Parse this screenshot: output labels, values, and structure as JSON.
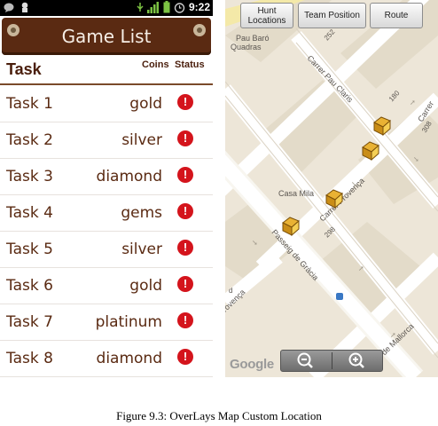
{
  "status_bar": {
    "time": "9:22"
  },
  "header": {
    "title": "Game List"
  },
  "columns": {
    "task": "Task",
    "coins": "Coins",
    "status": "Status"
  },
  "tasks": [
    {
      "name": "Task 1",
      "coins": "gold",
      "status_icon": "alert-icon"
    },
    {
      "name": "Task 2",
      "coins": "silver",
      "status_icon": "alert-icon"
    },
    {
      "name": "Task 3",
      "coins": "diamond",
      "status_icon": "alert-icon"
    },
    {
      "name": "Task 4",
      "coins": "gems",
      "status_icon": "alert-icon"
    },
    {
      "name": "Task 5",
      "coins": "silver",
      "status_icon": "alert-icon"
    },
    {
      "name": "Task 6",
      "coins": "gold",
      "status_icon": "alert-icon"
    },
    {
      "name": "Task 7",
      "coins": "platinum",
      "status_icon": "alert-icon"
    },
    {
      "name": "Task 8",
      "coins": "diamond",
      "status_icon": "alert-icon"
    }
  ],
  "map": {
    "buttons": {
      "hunt": "Hunt Locations",
      "team": "Team Position",
      "route": "Route"
    },
    "labels": {
      "pau_baro": "Pau Baró",
      "quadras": "Quadras",
      "pau_claris": "Carrer Pau Claris",
      "carrer": "Carrer",
      "casa_mila": "Casa Mila",
      "provenca": "Carrer Provença",
      "passeig": "Passeig de Gràcia",
      "provenca_bottom": "rovença",
      "mallorca": "rer de Mallorca",
      "n252": "252",
      "n180": "180",
      "n308": "308",
      "n298": "298",
      "d": "d"
    },
    "google": "Google",
    "zoom_out": "zoom-out-icon",
    "zoom_in": "zoom-in-icon"
  },
  "caption": "Figure 9.3: OverLays Map  Custom Location"
}
